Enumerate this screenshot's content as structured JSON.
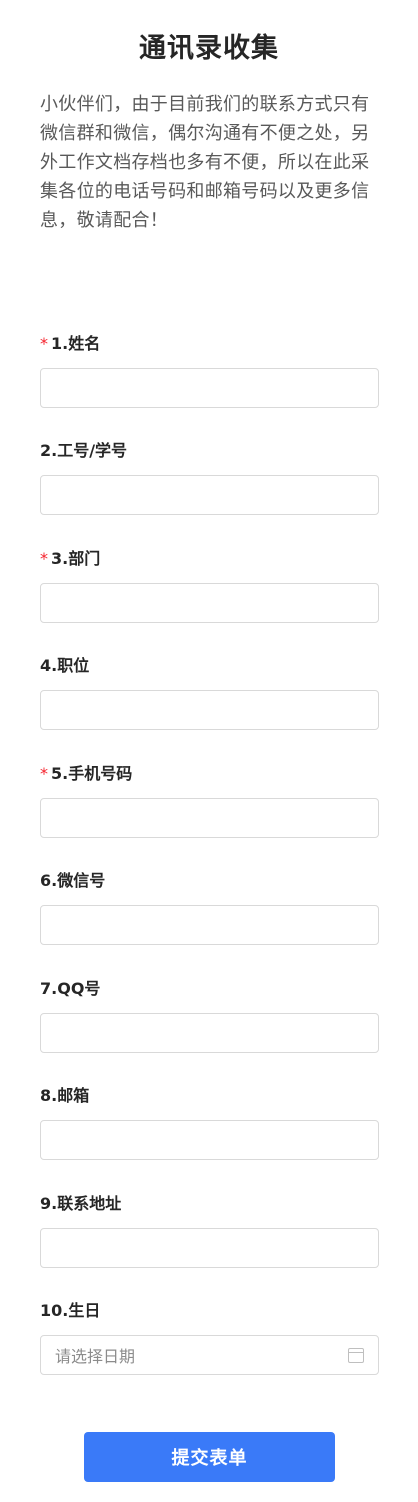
{
  "form": {
    "title": "通讯录收集",
    "description": "小伙伴们，由于目前我们的联系方式只有微信群和微信，偶尔沟通有不便之处，另外工作文档存档也多有不便，所以在此采集各位的电话号码和邮箱号码以及更多信息，敬请配合！",
    "required_mark": "*",
    "fields": [
      {
        "label": "1.姓名",
        "required": true,
        "value": ""
      },
      {
        "label": "2.工号/学号",
        "required": false,
        "value": ""
      },
      {
        "label": "3.部门",
        "required": true,
        "value": ""
      },
      {
        "label": "4.职位",
        "required": false,
        "value": ""
      },
      {
        "label": "5.手机号码",
        "required": true,
        "value": ""
      },
      {
        "label": "6.微信号",
        "required": false,
        "value": ""
      },
      {
        "label": "7.QQ号",
        "required": false,
        "value": ""
      },
      {
        "label": "8.邮箱",
        "required": false,
        "value": ""
      },
      {
        "label": "9.联系地址",
        "required": false,
        "value": ""
      },
      {
        "label": "10.生日",
        "required": false,
        "placeholder": "请选择日期",
        "icon": "calendar-icon"
      }
    ],
    "submit_label": "提交表单"
  },
  "colors": {
    "accent": "#3a7af8",
    "required": "#f5222d",
    "border": "#d9d9d9"
  }
}
